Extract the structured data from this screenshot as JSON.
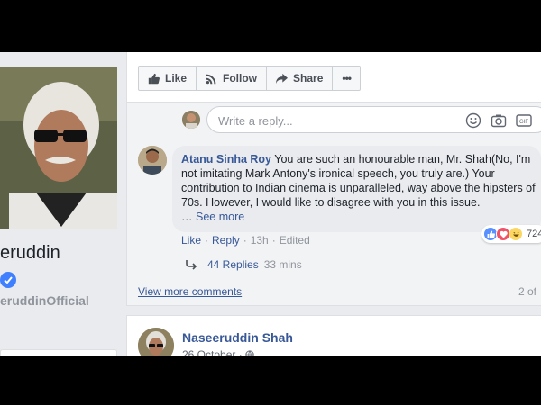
{
  "post_actions": {
    "like_label": "Like",
    "follow_label": "Follow",
    "share_label": "Share",
    "more_label": "•••"
  },
  "profile": {
    "name": "eruddin",
    "handle": "eruddinOfficial"
  },
  "reply_box": {
    "placeholder": "Write a reply..."
  },
  "comment": {
    "author": "Atanu Sinha Roy",
    "text": "You are such an honourable man, Mr. Shah(No, I'm not imitating Mark Antony's ironical speech, you truly are.) Your contribution to Indian cinema is unparalleled, way above the hipsters of 70s. However, I would like to disagree with you in this issue.",
    "ellipsis": "…",
    "see_more": "See more",
    "like_label": "Like",
    "reply_label": "Reply",
    "time": "13h",
    "edited": "Edited",
    "reaction_count": "724",
    "reactions": [
      "like",
      "love",
      "haha"
    ],
    "replies_label": "44 Replies",
    "replies_time": "33 mins"
  },
  "view_more_comments": "View more comments",
  "page_count": "2 of",
  "next_post": {
    "author": "Naseeruddin Shah",
    "date": "26 October ·"
  },
  "colors": {
    "link": "#385898",
    "like_blue": "#5890ff",
    "love_red": "#f25268",
    "haha_yellow": "#fcd662",
    "verified_blue": "#4080ff"
  }
}
